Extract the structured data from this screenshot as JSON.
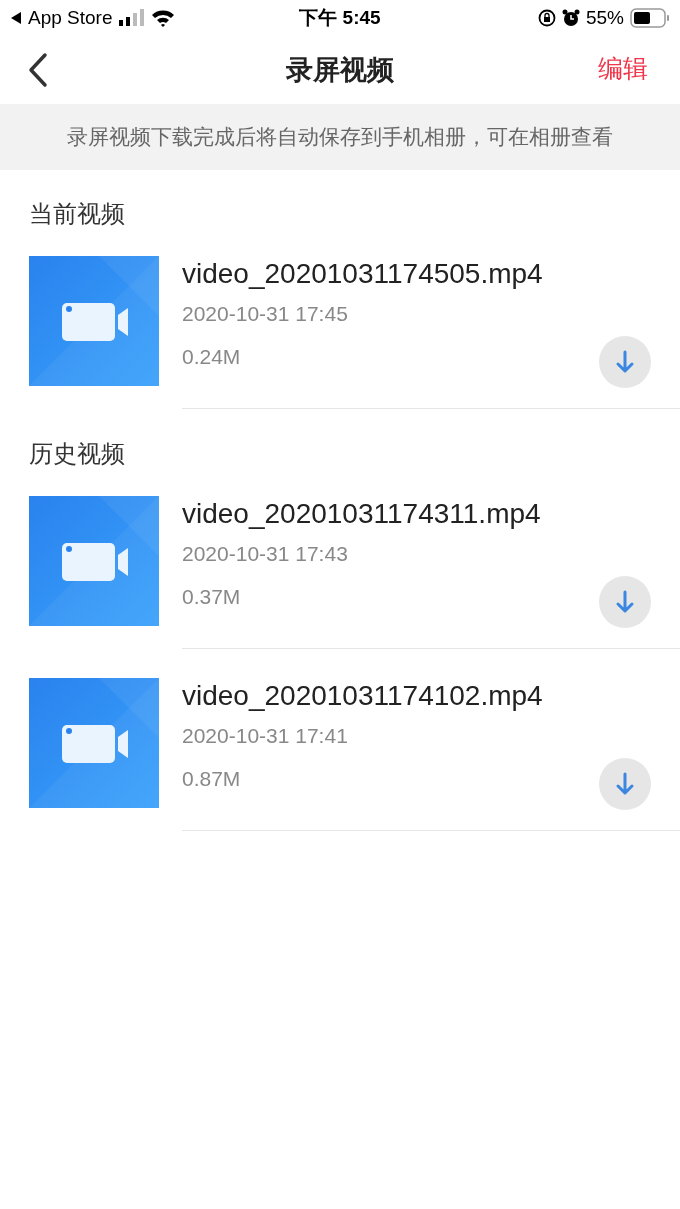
{
  "status_bar": {
    "back_app": "App Store",
    "time": "下午 5:45",
    "battery": "55%"
  },
  "nav": {
    "title": "录屏视频",
    "action": "编辑"
  },
  "notice": "录屏视频下载完成后将自动保存到手机相册，可在相册查看",
  "sections": [
    {
      "title": "当前视频",
      "videos": [
        {
          "name": "video_20201031174505.mp4",
          "date": "2020-10-31 17:45",
          "size": "0.24M"
        }
      ]
    },
    {
      "title": "历史视频",
      "videos": [
        {
          "name": "video_20201031174311.mp4",
          "date": "2020-10-31 17:43",
          "size": "0.37M"
        },
        {
          "name": "video_20201031174102.mp4",
          "date": "2020-10-31 17:41",
          "size": "0.87M"
        }
      ]
    }
  ]
}
